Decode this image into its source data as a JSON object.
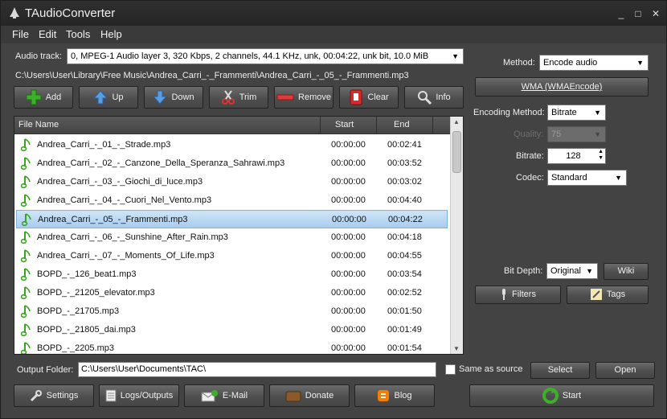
{
  "window": {
    "title": "TAudioConverter"
  },
  "menu": [
    "File",
    "Edit",
    "Tools",
    "Help"
  ],
  "audio_track": {
    "label": "Audio track:",
    "value": "0, MPEG-1 Audio layer 3, 320 Kbps, 2 channels, 44.1 KHz, unk, 00:04:22, unk bit, 10.0 MiB"
  },
  "current_path": "C:\\Users\\User\\Library\\Free Music\\Andrea_Carri_-_Frammenti\\Andrea_Carri_-_05_-_Frammenti.mp3",
  "toolbar": {
    "add": "Add",
    "up": "Up",
    "down": "Down",
    "trim": "Trim",
    "remove": "Remove",
    "clear": "Clear",
    "info": "Info"
  },
  "list": {
    "headers": {
      "name": "File Name",
      "start": "Start",
      "end": "End"
    },
    "rows": [
      {
        "name": "Andrea_Carri_-_01_-_Strade.mp3",
        "start": "00:00:00",
        "end": "00:02:41"
      },
      {
        "name": "Andrea_Carri_-_02_-_Canzone_Della_Speranza_Sahrawi.mp3",
        "start": "00:00:00",
        "end": "00:03:52"
      },
      {
        "name": "Andrea_Carri_-_03_-_Giochi_di_luce.mp3",
        "start": "00:00:00",
        "end": "00:03:02"
      },
      {
        "name": "Andrea_Carri_-_04_-_Cuori_Nel_Vento.mp3",
        "start": "00:00:00",
        "end": "00:04:40"
      },
      {
        "name": "Andrea_Carri_-_05_-_Frammenti.mp3",
        "start": "00:00:00",
        "end": "00:04:22"
      },
      {
        "name": "Andrea_Carri_-_06_-_Sunshine_After_Rain.mp3",
        "start": "00:00:00",
        "end": "00:04:18"
      },
      {
        "name": "Andrea_Carri_-_07_-_Moments_Of_Life.mp3",
        "start": "00:00:00",
        "end": "00:04:55"
      },
      {
        "name": "BOPD_-_126_beat1.mp3",
        "start": "00:00:00",
        "end": "00:03:54"
      },
      {
        "name": "BOPD_-_21205_elevator.mp3",
        "start": "00:00:00",
        "end": "00:02:52"
      },
      {
        "name": "BOPD_-_21705.mp3",
        "start": "00:00:00",
        "end": "00:01:50"
      },
      {
        "name": "BOPD_-_21805_dai.mp3",
        "start": "00:00:00",
        "end": "00:01:49"
      },
      {
        "name": "BOPD_-_2205.mp3",
        "start": "00:00:00",
        "end": "00:01:54"
      }
    ]
  },
  "settings": {
    "method_label": "Method:",
    "method_value": "Encode audio",
    "encoder_button": "WMA (WMAEncode)",
    "encoding_method_label": "Encoding Method:",
    "encoding_method_value": "Bitrate",
    "quality_label": "Quality:",
    "quality_value": "75",
    "bitrate_label": "Bitrate:",
    "bitrate_value": "128",
    "codec_label": "Codec:",
    "codec_value": "Standard",
    "bit_depth_label": "Bit Depth:",
    "bit_depth_value": "Original",
    "wiki": "Wiki",
    "filters": "Filters",
    "tags": "Tags"
  },
  "output": {
    "label": "Output Folder:",
    "path": "C:\\Users\\User\\Documents\\TAC\\",
    "same_as_source": "Same as source",
    "select": "Select",
    "open": "Open"
  },
  "bottom": {
    "settings": "Settings",
    "logs": "Logs/Outputs",
    "email": "E-Mail",
    "donate": "Donate",
    "blog": "Blog",
    "start": "Start"
  },
  "colors": {
    "accent_selection": "#a9cdef",
    "note_green": "#3aa31f"
  }
}
